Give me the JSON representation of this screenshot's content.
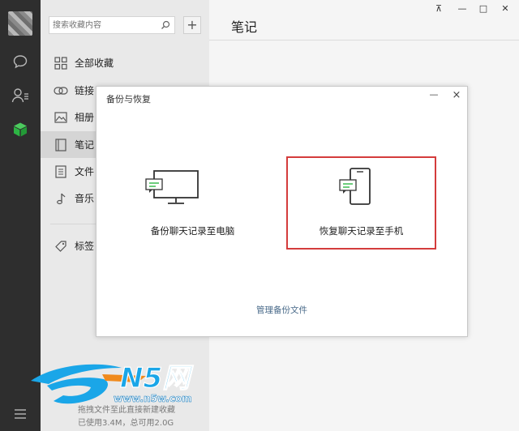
{
  "colors": {
    "rail_bg": "#2e2e2e",
    "accent_green": "#2db544",
    "highlight_red": "#d43c3c",
    "link_blue": "#4a6b8a"
  },
  "sidebar": {
    "icons": [
      "chat-bubble-icon",
      "contacts-icon",
      "favorites-cube-icon",
      "menu-icon"
    ]
  },
  "search": {
    "placeholder": "搜索收藏内容",
    "add_label": "+"
  },
  "nav": {
    "items": [
      {
        "label": "全部收藏",
        "icon": "grid-icon"
      },
      {
        "label": "链接",
        "icon": "link-icon"
      },
      {
        "label": "相册",
        "icon": "image-icon"
      },
      {
        "label": "笔记",
        "icon": "note-icon",
        "selected": true
      },
      {
        "label": "文件",
        "icon": "file-icon"
      },
      {
        "label": "音乐",
        "icon": "music-icon"
      },
      {
        "label": "标签",
        "icon": "tag-icon"
      }
    ]
  },
  "storage": {
    "hint": "拖拽文件至此直接新建收藏",
    "usage": "已使用3.4M，总可用2.0G"
  },
  "header": {
    "title": "笔记",
    "pin": "⊼",
    "minimize": "—",
    "maximize": "□",
    "close": "✕"
  },
  "dialog": {
    "title": "备份与恢复",
    "minimize": "—",
    "close": "×",
    "backup_label": "备份聊天记录至电脑",
    "restore_label": "恢复聊天记录至手机",
    "manage_link": "管理备份文件"
  },
  "watermark": {
    "brand": "N5网",
    "url": "www.n5w.com"
  }
}
